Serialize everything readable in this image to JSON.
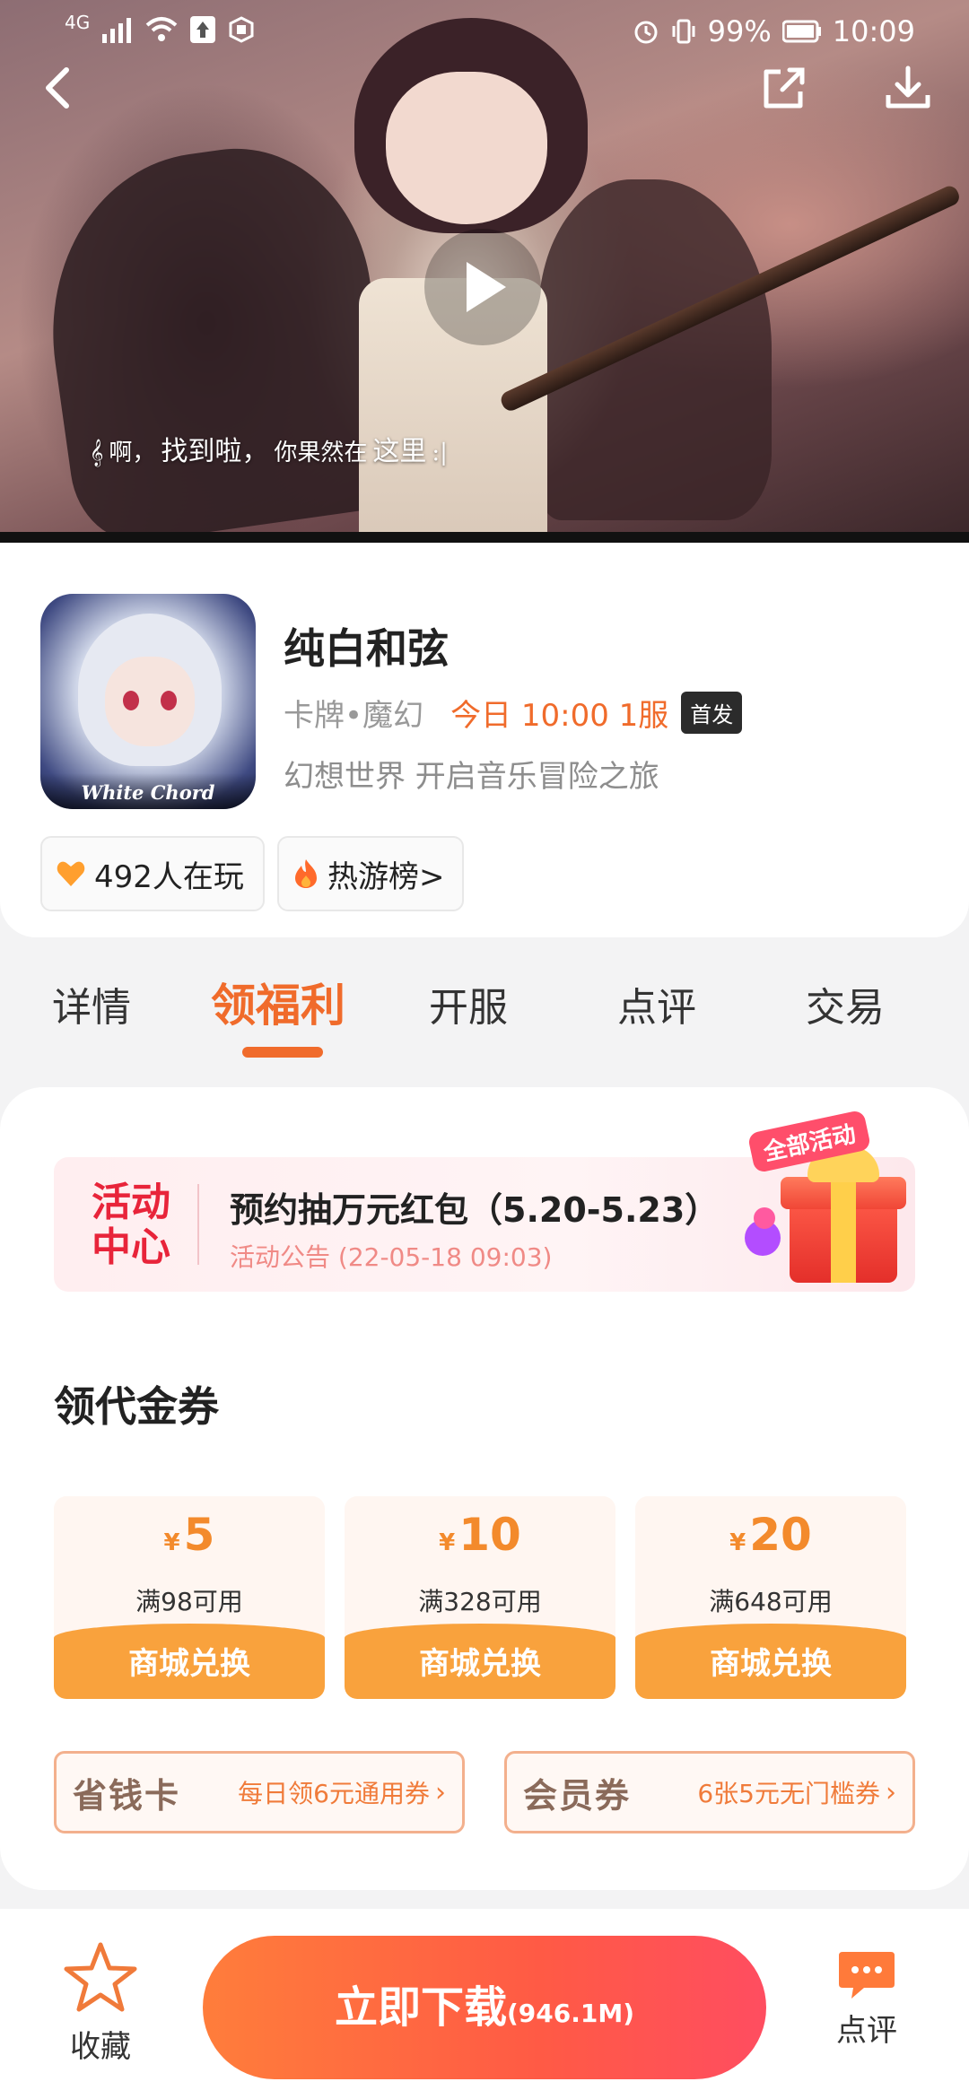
{
  "status_bar": {
    "signal": "4G",
    "battery": "99%",
    "time": "10:09"
  },
  "hero": {
    "subtitle_small": "啊，",
    "subtitle_big": "找到啦，",
    "subtitle_small2": "你果然在",
    "subtitle_big2": "这里"
  },
  "app": {
    "icon_logo": "White Chord",
    "title": "纯白和弦",
    "genre": "卡牌•魔幻",
    "server_time": "今日 10:00 1服",
    "badge": "首发",
    "description": "幻想世界 开启音乐冒险之旅",
    "players": "492人在玩",
    "hotlist": "热游榜>"
  },
  "tabs": [
    {
      "label": "详情"
    },
    {
      "label": "领福利"
    },
    {
      "label": "开服"
    },
    {
      "label": "点评"
    },
    {
      "label": "交易"
    }
  ],
  "activity": {
    "label_line1": "活动",
    "label_line2": "中心",
    "title": "预约抽万元红包（5.20-5.23）",
    "subtitle": "活动公告 (22-05-18 09:03)",
    "tag": "全部活动"
  },
  "coupons_section": {
    "title": "领代金券",
    "currency": "¥",
    "items": [
      {
        "amount": "5",
        "condition": "满98可用",
        "action": "商城兑换"
      },
      {
        "amount": "10",
        "condition": "满328可用",
        "action": "商城兑换"
      },
      {
        "amount": "20",
        "condition": "满648可用",
        "action": "商城兑换"
      }
    ]
  },
  "promos": [
    {
      "name": "省钱卡",
      "desc": "每日领6元通用券"
    },
    {
      "name": "会员券",
      "desc": "6张5元无门槛券"
    }
  ],
  "bottom": {
    "favorite": "收藏",
    "download": "立即下载",
    "size": "(946.1M)",
    "review": "点评"
  },
  "colors": {
    "accent": "#f06b2b",
    "coupon": "#f9a23d",
    "activity_red": "#e8243a"
  }
}
